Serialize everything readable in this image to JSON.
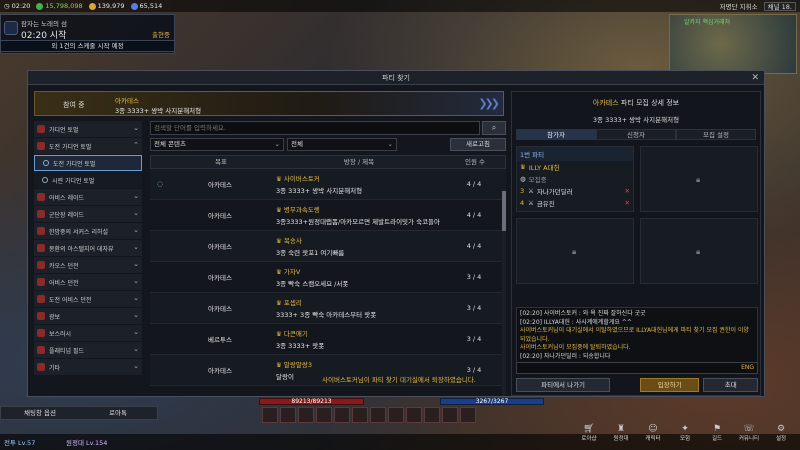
{
  "topbar": {
    "time": "02:20",
    "silver": "15,798,098",
    "gold": "139,979",
    "crystal": "65,514",
    "region": "저명단 지휘소",
    "channel": "채널 18."
  },
  "event": {
    "title": "잠자는 노래의 섬",
    "time": "02:20 시작",
    "depart": "출현중",
    "sub": "외 1건의 스케줄 시작 예정"
  },
  "minimap": {
    "location": "알카지\n핵심거래처"
  },
  "dialog": {
    "title": "파티 찾기",
    "current_label": "참여 중",
    "current_category": "아카테스",
    "current_name": "3종 3333+ 쌍박 사지분해처형"
  },
  "sidebar": {
    "items": [
      {
        "label": "가디언 토벌",
        "icon": "raid-icon",
        "type": "main"
      },
      {
        "label": "도전 가디언 토벌",
        "icon": "raid-icon",
        "type": "main"
      },
      {
        "label": "도전 가디언 토벌",
        "icon": "circle-icon",
        "type": "sub",
        "selected": true
      },
      {
        "label": "시련 가디언 토벌",
        "icon": "dot-icon",
        "type": "sub"
      },
      {
        "label": "어비스 레이드",
        "icon": "raid-icon",
        "type": "main"
      },
      {
        "label": "군단장 레이드",
        "icon": "raid-icon",
        "type": "main"
      },
      {
        "label": "한밤중의 서커스 리허설",
        "icon": "raid-icon",
        "type": "main"
      },
      {
        "label": "몽환의 아스탤지어 데자뷰",
        "icon": "raid-icon",
        "type": "main"
      },
      {
        "label": "카오스 던전",
        "icon": "raid-icon",
        "type": "main"
      },
      {
        "label": "어비스 던전",
        "icon": "raid-icon",
        "type": "main"
      },
      {
        "label": "도전 어비스 던전",
        "icon": "raid-icon",
        "type": "main"
      },
      {
        "label": "광보",
        "icon": "raid-icon",
        "type": "main"
      },
      {
        "label": "보스러시",
        "icon": "raid-icon",
        "type": "main"
      },
      {
        "label": "플래티넘 필드",
        "icon": "raid-icon",
        "type": "main"
      },
      {
        "label": "기타",
        "icon": "raid-icon",
        "type": "main"
      }
    ]
  },
  "list": {
    "search_placeholder": "검색할 단어를 입력하세요.",
    "filter_content": "전체 콘텐츠",
    "filter_all": "전체",
    "refresh_label": "새로고침",
    "headers": [
      "목표",
      "방장 / 제목",
      "인원 수"
    ],
    "rows": [
      {
        "target": "아카테스",
        "leader": "사이버스토커",
        "title": "3종 3333+ 쌍박 사지분해처형",
        "count": "4 / 4",
        "mine": true
      },
      {
        "target": "아카테스",
        "leader": "병무과속도렝",
        "title": "3종3333+원정대랩폼/아카모르면 제발트라이밋가 숙코들아",
        "count": "4 / 4"
      },
      {
        "target": "아카테스",
        "leader": "복송사",
        "title": "3종 숙련 랏포1 여기빠름",
        "count": "4 / 4"
      },
      {
        "target": "아카테스",
        "leader": "가자V",
        "title": "3종 빡숙 스캠오세요 /서폿",
        "count": "3 / 4"
      },
      {
        "target": "아카테스",
        "leader": "포셉리",
        "title": "3333+ 3종 빡숙 아카테스부터 랏폿",
        "count": "3 / 4"
      },
      {
        "target": "베르투스",
        "leader": "다큰애기",
        "title": "3종 3333+ 랏폿",
        "count": "3 / 4"
      },
      {
        "target": "아카테스",
        "leader": "말랑말랑3",
        "title": "달랑이",
        "count": "3 / 4"
      }
    ],
    "notice": "사이버스토커님이 파티 찾기 대기실에서 퇴장하였습니다."
  },
  "detail": {
    "title_category": "아카테스",
    "title_suffix": "파티 모집 상세 정보",
    "subtitle": "3종 3333+ 쌍박 사지분해처형",
    "tabs": [
      "참가자",
      "신청자",
      "모집 설정"
    ],
    "party_head": "1번 파티",
    "members": [
      {
        "num": "",
        "name": "ILLY A대헌",
        "leader": true,
        "kick": false
      },
      {
        "num": "",
        "name": "모집중",
        "leader": false,
        "kick": false
      },
      {
        "num": "3",
        "name": "자나가던딜러",
        "leader": false,
        "kick": true
      },
      {
        "num": "4",
        "name": "금유진",
        "leader": false,
        "kick": true
      }
    ],
    "chat": [
      {
        "text": "[02:20] 사이버스토커 : 와 욕 진짜 잘하신다 굿굿",
        "sys": false
      },
      {
        "text": "[02:20] ILLYA대헌 : 사사계에계할게요 ^^",
        "sys": false
      },
      {
        "text": "사이버스토커님이 대기실에서 이탈하였으므로 ILLYA대헌님에게 파티 찾기 모집 권한이 이양되었습니다.",
        "sys": true
      },
      {
        "text": "사이버스토커님이 모집중에 탈퇴하였습니다.",
        "sys": true
      },
      {
        "text": "[02:20] 자나가던딜러 : 되송합니다",
        "sys": false
      }
    ],
    "chat_lang": "ENG",
    "leave_label": "파티에서 나가기",
    "start_label": "입장하기",
    "invite_label": "초대"
  },
  "hud": {
    "hp": "89213/89213",
    "mp": "3267/3267",
    "chat_option": "채팅창 옵션",
    "loa_talk": "로아톡",
    "party1": "전투 Lv.57",
    "party2": "원정대 Lv.154",
    "menu": [
      "로아샵",
      "원정대",
      "캐릭터",
      "모험",
      "길드",
      "커뮤니티",
      "설정"
    ]
  },
  "colors": {
    "accent_gold": "#e2b94a",
    "primary_button": "#6a4c17",
    "kick_red": "#e0443a"
  }
}
